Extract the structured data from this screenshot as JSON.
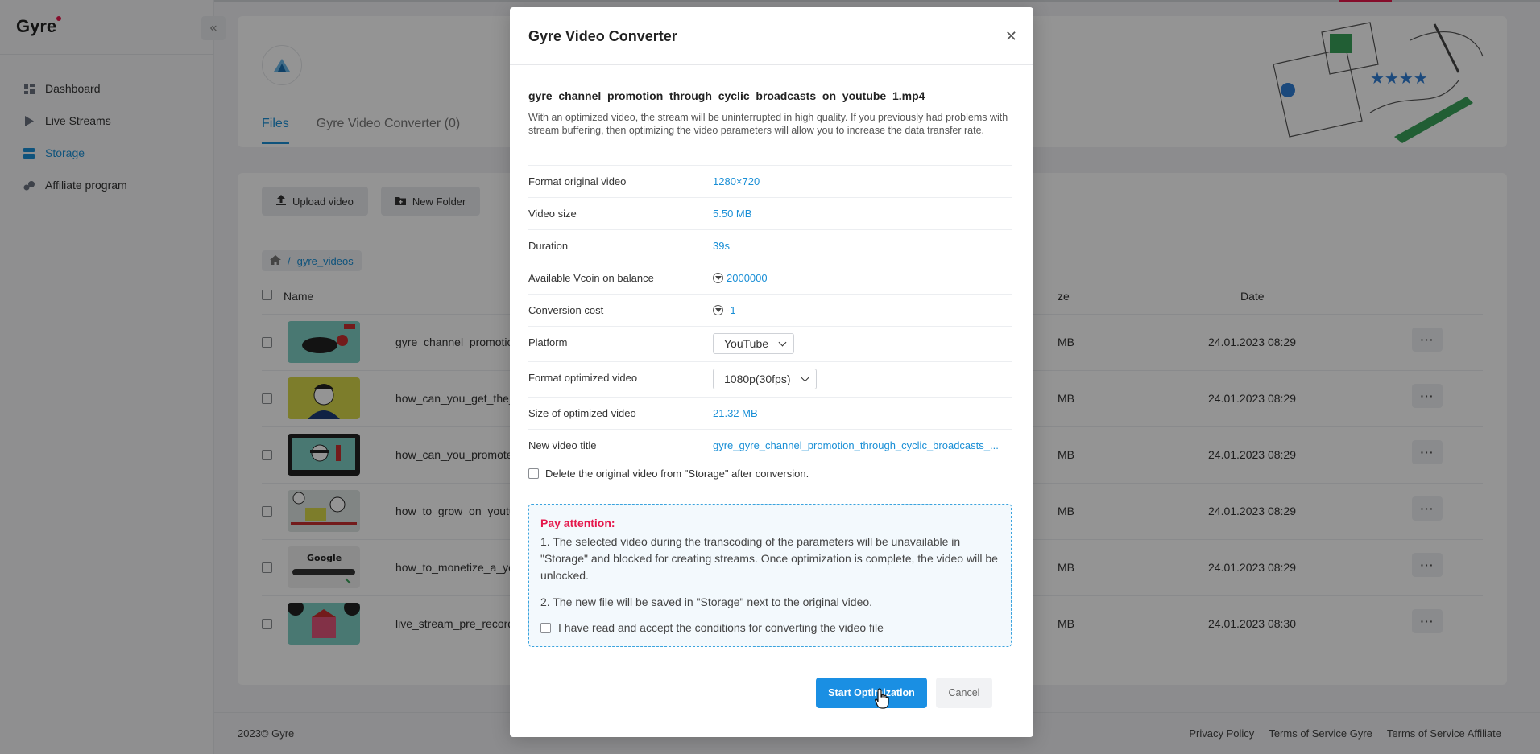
{
  "app": {
    "logo": "Gyre",
    "brand_color": "#e5174b",
    "accent_color": "#1a8fd6"
  },
  "sidebar": {
    "items": [
      {
        "label": "Dashboard",
        "icon": "dashboard-icon"
      },
      {
        "label": "Live Streams",
        "icon": "play-icon"
      },
      {
        "label": "Storage",
        "icon": "storage-icon",
        "active": true
      },
      {
        "label": "Affiliate program",
        "icon": "affiliate-icon"
      }
    ]
  },
  "main": {
    "tabs": [
      {
        "label": "Files"
      },
      {
        "label": "Gyre Video Converter (0)"
      }
    ],
    "toolbar": {
      "upload": "Upload video",
      "new_folder": "New Folder"
    },
    "breadcrumb": "gyre_videos",
    "table": {
      "headers": {
        "name": "Name",
        "size": "ze",
        "date": "Date"
      },
      "rows": [
        {
          "name": "gyre_channel_promotion_t",
          "size": "MB",
          "date": "24.01.2023 08:29"
        },
        {
          "name": "how_can_you_get_the_mo",
          "size": "MB",
          "date": "24.01.2023 08:29"
        },
        {
          "name": "how_can_you_promote_yo",
          "size": "MB",
          "date": "24.01.2023 08:29"
        },
        {
          "name": "how_to_grow_on_youtube_",
          "size": "MB",
          "date": "24.01.2023 08:29"
        },
        {
          "name": "how_to_monetize_a_youtu",
          "size": "MB",
          "date": "24.01.2023 08:29"
        },
        {
          "name": "live_stream_pre_recorded_",
          "size": "MB",
          "date": "24.01.2023 08:30"
        }
      ]
    }
  },
  "footer": {
    "copyright": "2023© Gyre",
    "links": [
      "Privacy Policy",
      "Terms of Service Gyre",
      "Terms of Service Affiliate"
    ]
  },
  "modal": {
    "title": "Gyre Video Converter",
    "filename": "gyre_channel_promotion_through_cyclic_broadcasts_on_youtube_1.mp4",
    "description": "With an optimized video, the stream will be uninterrupted in high quality. If you previously had problems with stream buffering, then optimizing the video parameters will allow you to increase the data transfer rate.",
    "rows": {
      "format_original": {
        "label": "Format original video",
        "value": "1280×720"
      },
      "video_size": {
        "label": "Video size",
        "value": "5.50 MB"
      },
      "duration": {
        "label": "Duration",
        "value": "39s"
      },
      "vcoin_balance": {
        "label": "Available Vcoin on balance",
        "value": "2000000"
      },
      "conversion_cost": {
        "label": "Conversion cost",
        "value": "-1"
      },
      "platform": {
        "label": "Platform",
        "value": "YouTube"
      },
      "format_optimized": {
        "label": "Format optimized video",
        "value": "1080p(30fps)"
      },
      "size_optimized": {
        "label": "Size of optimized video",
        "value": "21.32 MB"
      },
      "new_title": {
        "label": "New video title",
        "value": "gyre_gyre_channel_promotion_through_cyclic_broadcasts_..."
      }
    },
    "delete_original": "Delete the original video from \"Storage\" after conversion.",
    "attention": {
      "title": "Pay attention:",
      "p1": "1. The selected video during the transcoding of the parameters will be unavailable in \"Storage\" and blocked for creating streams. Once optimization is complete, the video will be unlocked.",
      "p2": "2. The new file will be saved in \"Storage\" next to the original video.",
      "accept": "I have read and accept the conditions for converting the video file"
    },
    "start_button": "Start Optimization",
    "cancel_button": "Cancel"
  }
}
